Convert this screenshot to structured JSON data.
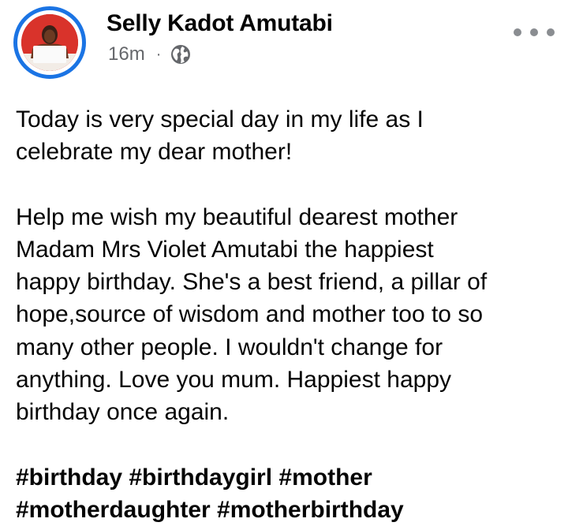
{
  "post": {
    "author": "Selly Kadot Amutabi",
    "time": "16m",
    "separator": "·",
    "privacy_icon": "globe-icon",
    "more_icon": "ellipsis-icon",
    "paragraphs": [
      [
        "Today is very special day in my life as I",
        "celebrate my dear mother!"
      ],
      [
        "Help me wish my beautiful dearest mother",
        "Madam Mrs Violet Amutabi the happiest",
        "happy birthday. She's a best friend, a pillar of",
        "hope,source of wisdom and mother too to so",
        "many other people. I wouldn't change for",
        "anything. Love you mum. Happiest happy",
        "birthday once again."
      ]
    ],
    "hashtag_lines": [
      "#birthday #birthdaygirl #mother",
      "#motherdaughter #motherbirthday"
    ]
  },
  "colors": {
    "avatar_ring": "#1b74e4",
    "meta_text": "#65676b",
    "body_text": "#050505"
  }
}
